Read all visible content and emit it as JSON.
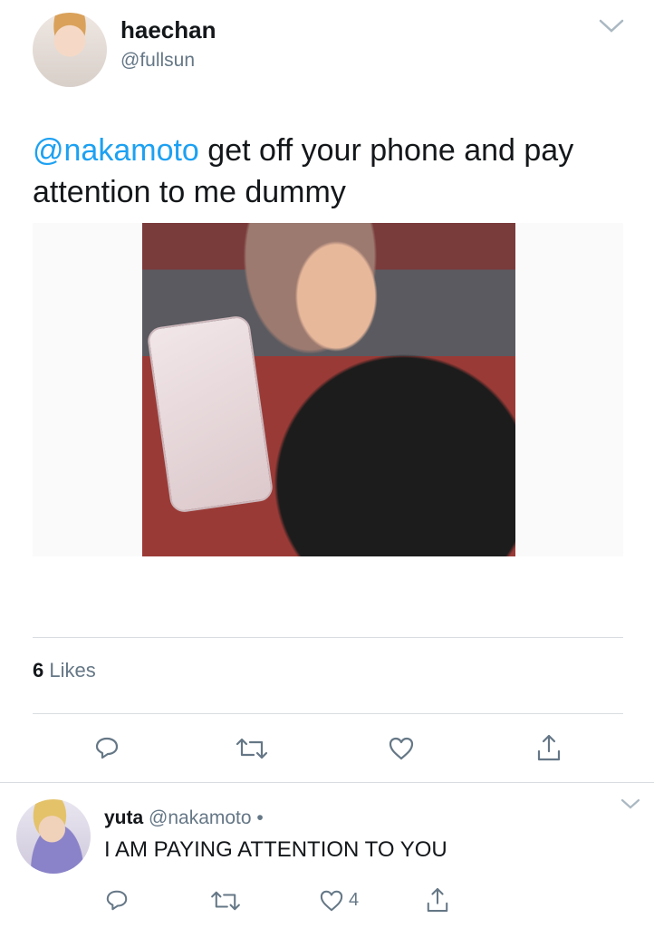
{
  "tweet": {
    "display_name": "haechan",
    "handle": "@fullsun",
    "mention": "@nakamoto",
    "text": " get off your phone and pay attention to me dummy",
    "likes_count": "6",
    "likes_label": "Likes"
  },
  "reply": {
    "display_name": "yuta",
    "handle": "@nakamoto",
    "separator": "•",
    "text": "I AM PAYING ATTENTION TO YOU",
    "like_count": "4"
  },
  "icons": {
    "caret": "chevron-down-icon",
    "reply": "reply-icon",
    "retweet": "retweet-icon",
    "like": "heart-icon",
    "share": "share-icon"
  },
  "colors": {
    "link": "#1da1f2",
    "muted": "#657786",
    "divider": "#d9dde1",
    "icon": "#657786"
  }
}
